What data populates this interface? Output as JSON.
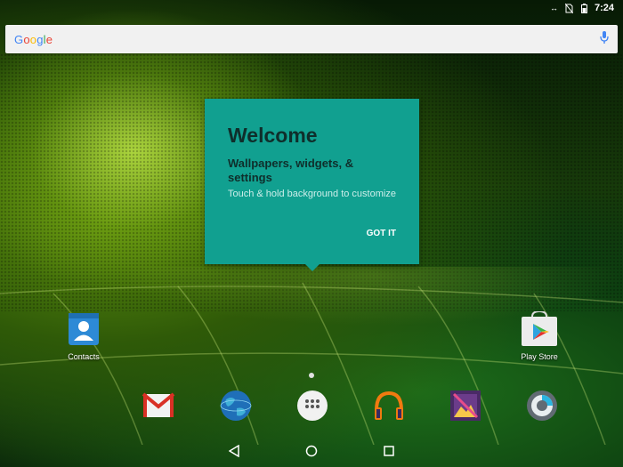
{
  "status_bar": {
    "time": "7:24"
  },
  "search": {
    "logo_text": "Google"
  },
  "welcome": {
    "title": "Welcome",
    "subtitle": "Wallpapers, widgets, & settings",
    "description": "Touch & hold background to customize",
    "button_label": "GOT IT",
    "background_color": "#11a090"
  },
  "home_apps": [
    {
      "label": "Contacts",
      "icon": "contacts-icon"
    },
    {
      "label": "Play Store",
      "icon": "play-store-icon"
    }
  ],
  "dock": [
    {
      "icon": "gmail-icon"
    },
    {
      "icon": "browser-globe-icon"
    },
    {
      "icon": "app-drawer-icon"
    },
    {
      "icon": "music-headphones-icon"
    },
    {
      "icon": "photos-icon"
    },
    {
      "icon": "camera-icon"
    }
  ],
  "navigation": [
    "back-icon",
    "home-icon",
    "recents-icon"
  ]
}
